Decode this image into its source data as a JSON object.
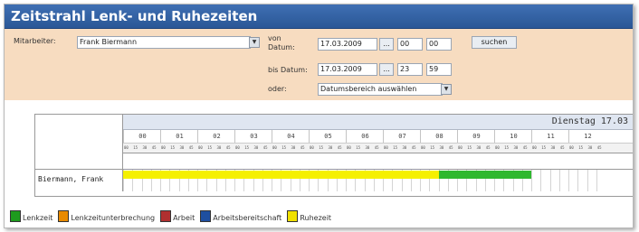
{
  "title": "Zeitstrahl Lenk- und Ruhezeiten",
  "form": {
    "mitarbeiter_label": "Mitarbeiter:",
    "mitarbeiter_value": "Frank Biermann",
    "von_label": "von Datum:",
    "von_date": "17.03.2009",
    "von_hour": "00",
    "von_min": "00",
    "bis_label": "bis Datum:",
    "bis_date": "17.03.2009",
    "bis_hour": "23",
    "bis_min": "59",
    "oder_label": "oder:",
    "range_select": "Datumsbereich auswählen",
    "search_button": "suchen",
    "date_picker_button": "..."
  },
  "timeline": {
    "day_label": "Dienstag 17.03",
    "hours": [
      "00",
      "01",
      "02",
      "03",
      "04",
      "05",
      "06",
      "07",
      "08",
      "09",
      "10",
      "11",
      "12"
    ],
    "minute_labels": [
      "00",
      "15",
      "30",
      "45"
    ],
    "row_name": "Biermann, Frank",
    "segments": [
      {
        "type": "Ruhezeit",
        "start": "00:00",
        "end": "08:30",
        "color": "#f5f000"
      },
      {
        "type": "Lenkzeit",
        "start": "08:30",
        "end": "11:00",
        "color": "#2eb82e"
      }
    ]
  },
  "legend": [
    {
      "label": "Lenkzeit",
      "icon": "steering-icon",
      "color": "#1e9b1e"
    },
    {
      "label": "Lenkzeitunterbrechung",
      "icon": "break-icon",
      "color": "#e88a00"
    },
    {
      "label": "Arbeit",
      "icon": "tools-icon",
      "color": "#b03030"
    },
    {
      "label": "Arbeitsbereitschaft",
      "icon": "standby-icon",
      "color": "#1f4fa0"
    },
    {
      "label": "Ruhezeit",
      "icon": "bed-icon",
      "color": "#f0e000"
    }
  ],
  "colors": {
    "title_bar": "#2f62a8",
    "form_bg": "#f7dcc0",
    "ruhezeit": "#f5f000",
    "lenkzeit": "#2eb82e"
  }
}
